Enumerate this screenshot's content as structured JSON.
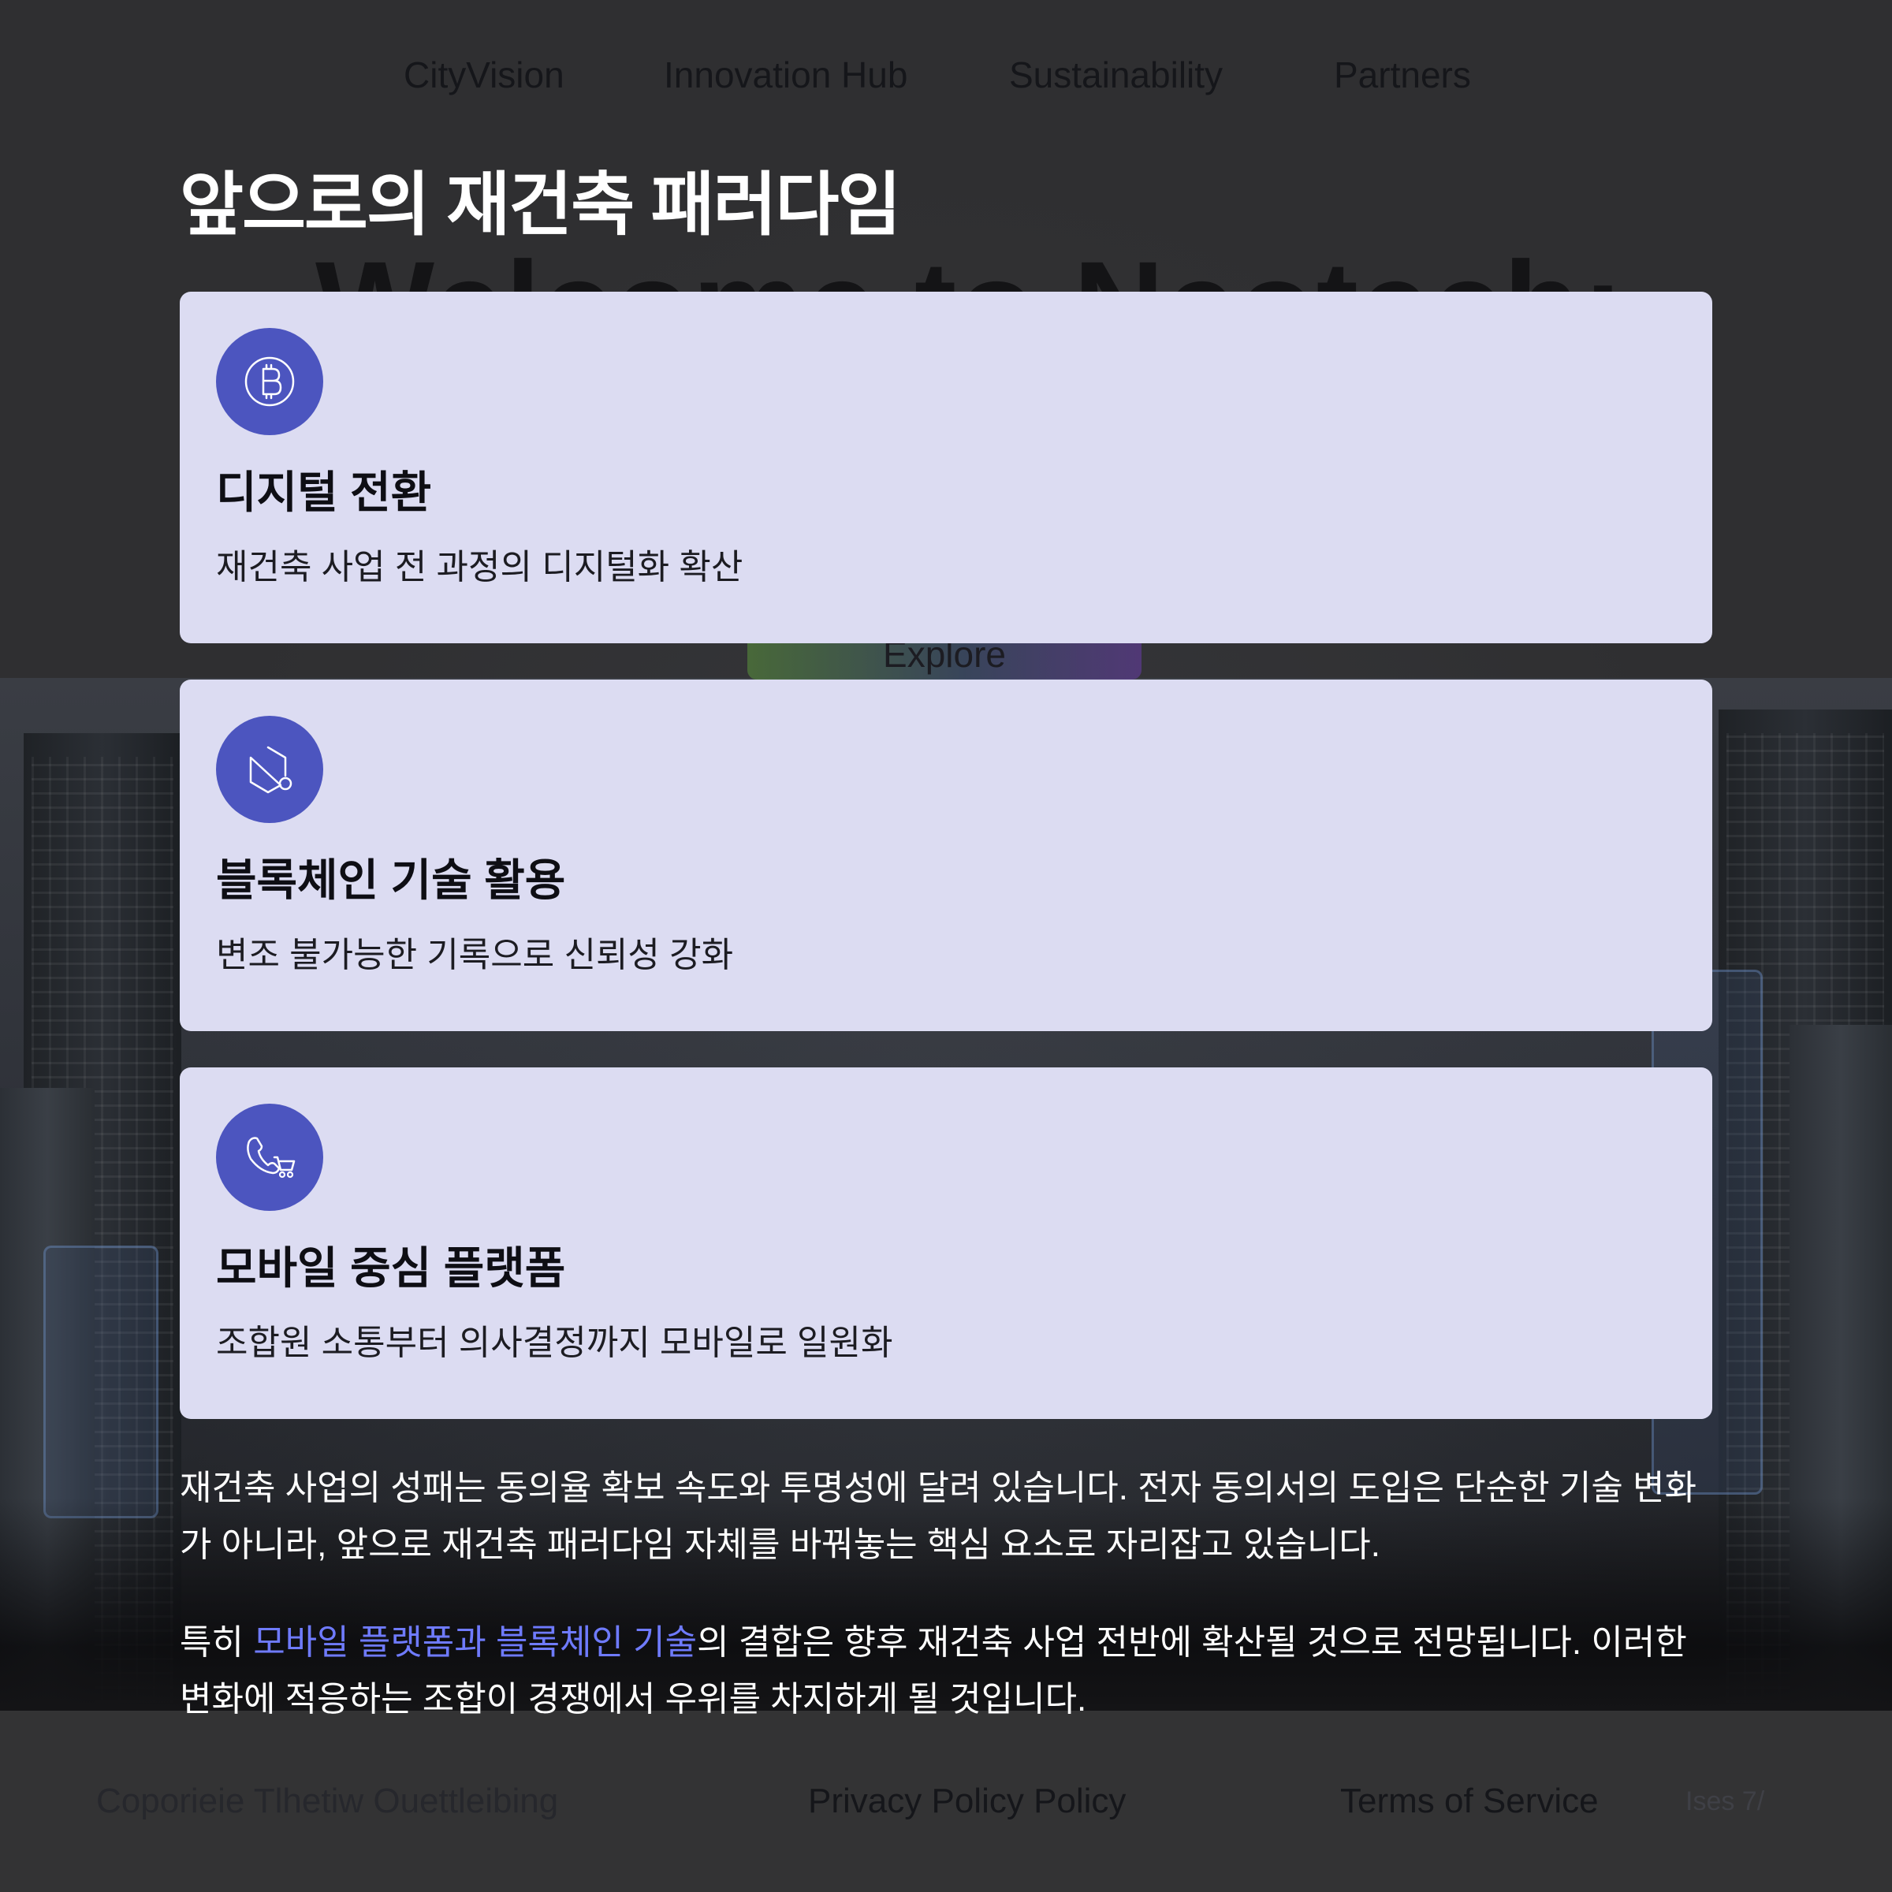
{
  "nav": {
    "items": [
      {
        "label": "CityVision"
      },
      {
        "label": "Innovation Hub"
      },
      {
        "label": "Sustainability"
      },
      {
        "label": "Partners"
      }
    ]
  },
  "hero": {
    "ghost_title": "Welcome to Neotech:",
    "explore_label": "Explore"
  },
  "section": {
    "title": "앞으로의 재건축 패러다임"
  },
  "cards": [
    {
      "icon": "bitcoin-icon",
      "title": "디지털 전환",
      "desc": "재건축 사업 전 과정의 디지털화 확산"
    },
    {
      "icon": "blockchain-hexagon-icon",
      "title": "블록체인 기술 활용",
      "desc": "변조 불가능한 기록으로 신뢰성 강화"
    },
    {
      "icon": "phone-cart-icon",
      "title": "모바일 중심 플랫폼",
      "desc": "조합원 소통부터 의사결정까지 모바일로 일원화"
    }
  ],
  "paragraphs": {
    "p1": "재건축 사업의 성패는 동의율 확보 속도와 투명성에 달려 있습니다. 전자 동의서의 도입은 단순한 기술 변화가 아니라, 앞으로 재건축 패러다임 자체를 바꿔놓는 핵심 요소로 자리잡고 있습니다.",
    "p2_before": "특히 ",
    "p2_highlight": "모바일 플랫폼과 블록체인 기술",
    "p2_after": "의 결합은 향후 재건축 사업 전반에 확산될 것으로 전망됩니다. 이러한 변화에 적응하는 조합이 경쟁에서 우위를 차지하게 될 것입니다."
  },
  "footer": {
    "copyright": "Coporieie Tlhetiw Ouettleibing",
    "privacy": "Privacy Policy Policy",
    "terms": "Terms of Service",
    "mark": "Ises 7/"
  },
  "colors": {
    "card_bg": "#dcdcf2",
    "icon_bg": "#4c55bf",
    "highlight": "#6f7bff",
    "page_bg": "#2f2f31"
  }
}
